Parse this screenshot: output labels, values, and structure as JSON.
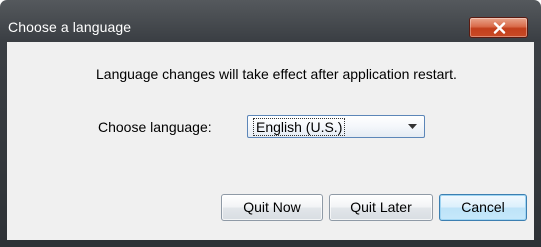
{
  "window": {
    "title": "Choose a language",
    "close_icon": "close-x-icon"
  },
  "dialog": {
    "message": "Language changes will take effect after application restart.",
    "language_label": "Choose language:",
    "language_select": {
      "value": "English (U.S.)",
      "arrow_icon": "chevron-down-icon"
    }
  },
  "buttons": {
    "quit_now": "Quit Now",
    "quit_later": "Quit Later",
    "cancel": "Cancel"
  },
  "colors": {
    "titlebar": "#3b3f44",
    "close_button": "#c94a26",
    "client_background": "#f0f0f0",
    "default_button_accent": "#bde3f8"
  }
}
